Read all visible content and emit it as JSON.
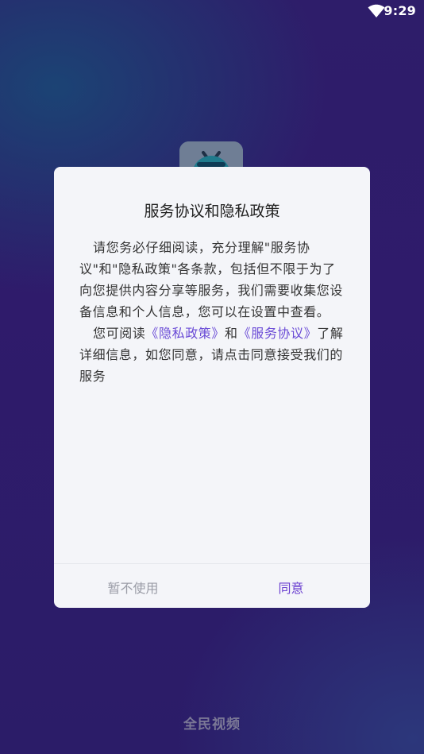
{
  "status_bar": {
    "time": "9:29",
    "wifi_icon": "wifi-icon"
  },
  "app_icon": {
    "icon": "tv-icon",
    "accent_color": "#1f7a8c"
  },
  "dialog": {
    "title": "服务协议和隐私政策",
    "paragraph1": "请您务必仔细阅读，充分理解\"服务协议\"和\"隐私政策\"各条款，包括但不限于为了向您提供内容分享等服务，我们需要收集您设备信息和个人信息，您可以在设置中查看。",
    "paragraph2": {
      "prefix": "您可阅读",
      "privacy_link": "《隐私政策》",
      "connector": "和",
      "service_link": "《服务协议》",
      "suffix": "了解详细信息，如您同意，请点击同意接受我们的服务"
    },
    "decline_label": "暂不使用",
    "agree_label": "同意"
  },
  "footer": {
    "app_name": "全民视频"
  },
  "colors": {
    "link": "#6a4bd6",
    "agree": "#6a3fd0",
    "decline": "#9a9ca6",
    "dialog_bg": "#f4f5f9",
    "background": "#2e1d6a"
  }
}
